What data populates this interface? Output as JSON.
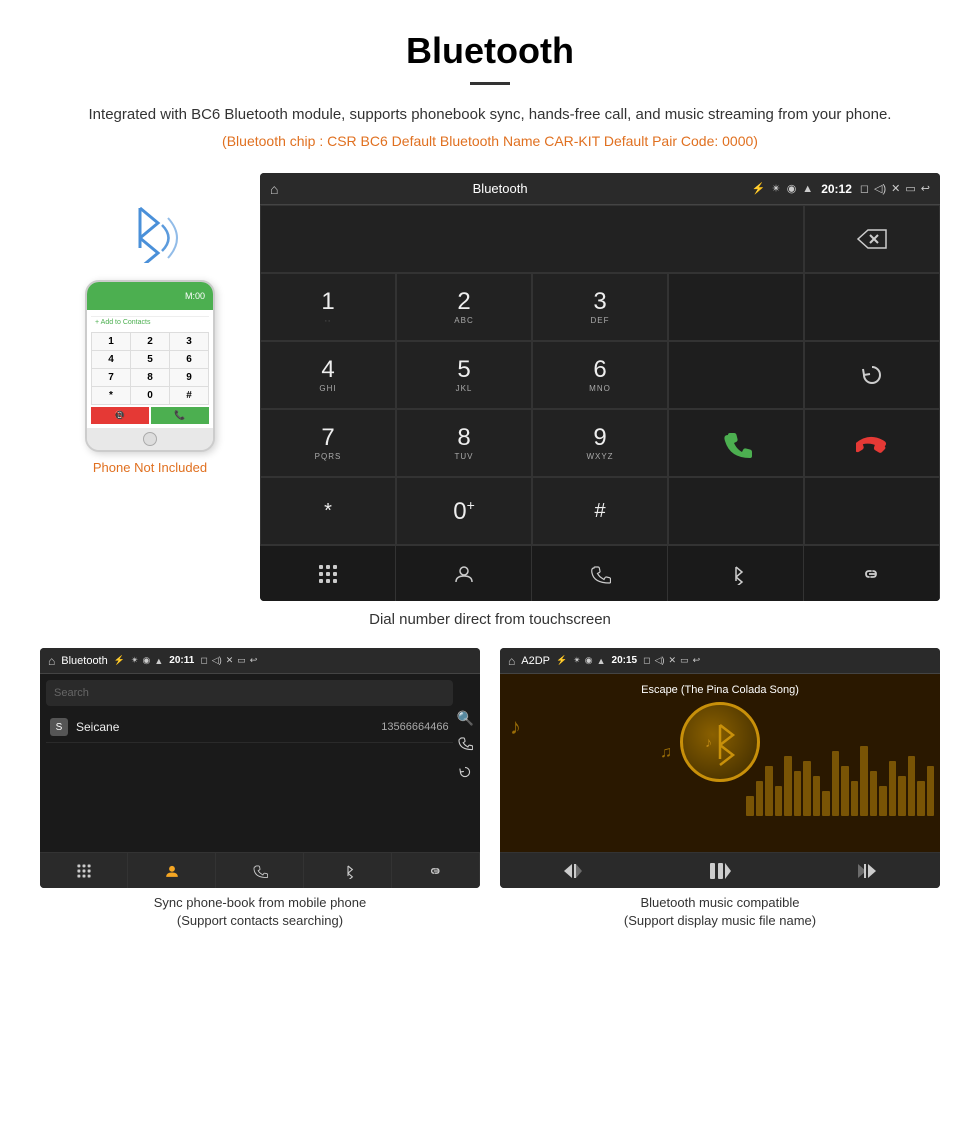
{
  "page": {
    "title": "Bluetooth",
    "description": "Integrated with BC6 Bluetooth module, supports phonebook sync, hands-free call, and music streaming from your phone.",
    "specs": "(Bluetooth chip : CSR BC6    Default Bluetooth Name CAR-KIT    Default Pair Code: 0000)"
  },
  "phone_illustration": {
    "not_included_label": "Phone Not Included",
    "green_bar_text": "M:00"
  },
  "dial_screen": {
    "header_title": "Bluetooth",
    "time": "20:12",
    "keys": [
      {
        "num": "1",
        "letters": ""
      },
      {
        "num": "2",
        "letters": "ABC"
      },
      {
        "num": "3",
        "letters": "DEF"
      },
      {
        "num": "4",
        "letters": "GHI"
      },
      {
        "num": "5",
        "letters": "JKL"
      },
      {
        "num": "6",
        "letters": "MNO"
      },
      {
        "num": "7",
        "letters": "PQRS"
      },
      {
        "num": "8",
        "letters": "TUV"
      },
      {
        "num": "9",
        "letters": "WXYZ"
      },
      {
        "num": "*",
        "letters": ""
      },
      {
        "num": "0+",
        "letters": ""
      },
      {
        "num": "#",
        "letters": ""
      }
    ],
    "caption": "Dial number direct from touchscreen"
  },
  "phonebook_screen": {
    "header_title": "Bluetooth",
    "time": "20:11",
    "search_placeholder": "Search",
    "contact_name": "Seicane",
    "contact_number": "13566664466",
    "contact_letter": "S",
    "caption_line1": "Sync phone-book from mobile phone",
    "caption_line2": "(Support contacts searching)"
  },
  "music_screen": {
    "header_title": "A2DP",
    "time": "20:15",
    "song_title": "Escape (The Pina Colada Song)",
    "caption_line1": "Bluetooth music compatible",
    "caption_line2": "(Support display music file name)"
  },
  "icons": {
    "home": "⌂",
    "usb": "⚡",
    "bluetooth": "⬡",
    "gps": "◉",
    "wifi": "▲",
    "battery": "▮",
    "camera": "◻",
    "volume": "◁",
    "close_x": "✕",
    "window": "▭",
    "back": "↩",
    "backspace": "⌫",
    "reload": "↺",
    "call_green": "✆",
    "call_red": "✆",
    "keypad": "⊞",
    "contacts": "👤",
    "phone_receiver": "✆",
    "bt_symbol": "✴",
    "link": "🔗",
    "prev": "⏮",
    "play_pause": "⏭",
    "next": "⏭",
    "music_note": "♪",
    "search_glass": "🔍"
  },
  "eq_bars": [
    20,
    35,
    50,
    30,
    60,
    45,
    55,
    40,
    25,
    65,
    50,
    35,
    70,
    45,
    30,
    55,
    40,
    60,
    35,
    50
  ]
}
